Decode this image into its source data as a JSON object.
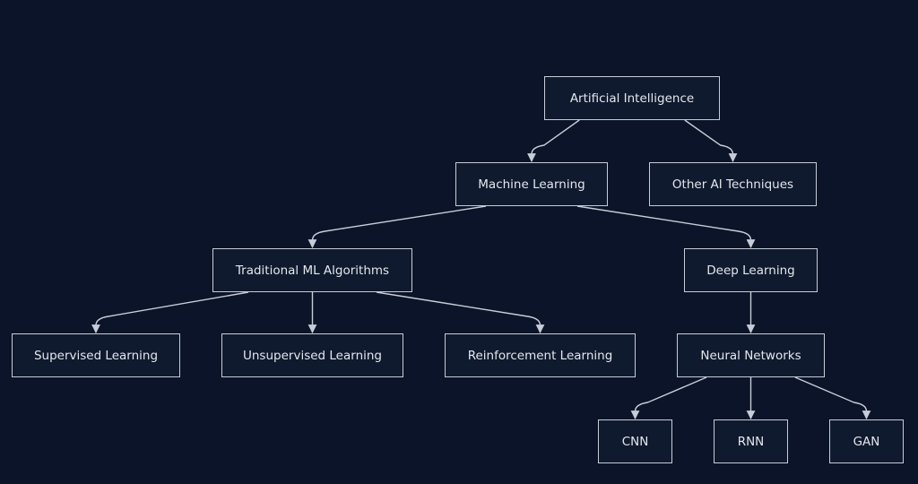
{
  "diagram": {
    "type": "flowchart-tree",
    "colors": {
      "background": "#0b1428",
      "node_fill": "#0f1a2e",
      "node_stroke": "#c7cdd8",
      "text": "#e3e7ee",
      "edge": "#c7cdd8"
    },
    "nodes": [
      {
        "id": "ai",
        "label": "Artificial Intelligence"
      },
      {
        "id": "ml",
        "label": "Machine Learning"
      },
      {
        "id": "other",
        "label": "Other AI Techniques"
      },
      {
        "id": "trad",
        "label": "Traditional ML Algorithms"
      },
      {
        "id": "dl",
        "label": "Deep Learning"
      },
      {
        "id": "sup",
        "label": "Supervised Learning"
      },
      {
        "id": "unsup",
        "label": "Unsupervised Learning"
      },
      {
        "id": "rl",
        "label": "Reinforcement Learning"
      },
      {
        "id": "nn",
        "label": "Neural Networks"
      },
      {
        "id": "cnn",
        "label": "CNN"
      },
      {
        "id": "rnn",
        "label": "RNN"
      },
      {
        "id": "gan",
        "label": "GAN"
      }
    ],
    "edges": [
      {
        "from": "ai",
        "to": "ml"
      },
      {
        "from": "ai",
        "to": "other"
      },
      {
        "from": "ml",
        "to": "trad"
      },
      {
        "from": "ml",
        "to": "dl"
      },
      {
        "from": "trad",
        "to": "sup"
      },
      {
        "from": "trad",
        "to": "unsup"
      },
      {
        "from": "trad",
        "to": "rl"
      },
      {
        "from": "dl",
        "to": "nn"
      },
      {
        "from": "nn",
        "to": "cnn"
      },
      {
        "from": "nn",
        "to": "rnn"
      },
      {
        "from": "nn",
        "to": "gan"
      }
    ]
  }
}
